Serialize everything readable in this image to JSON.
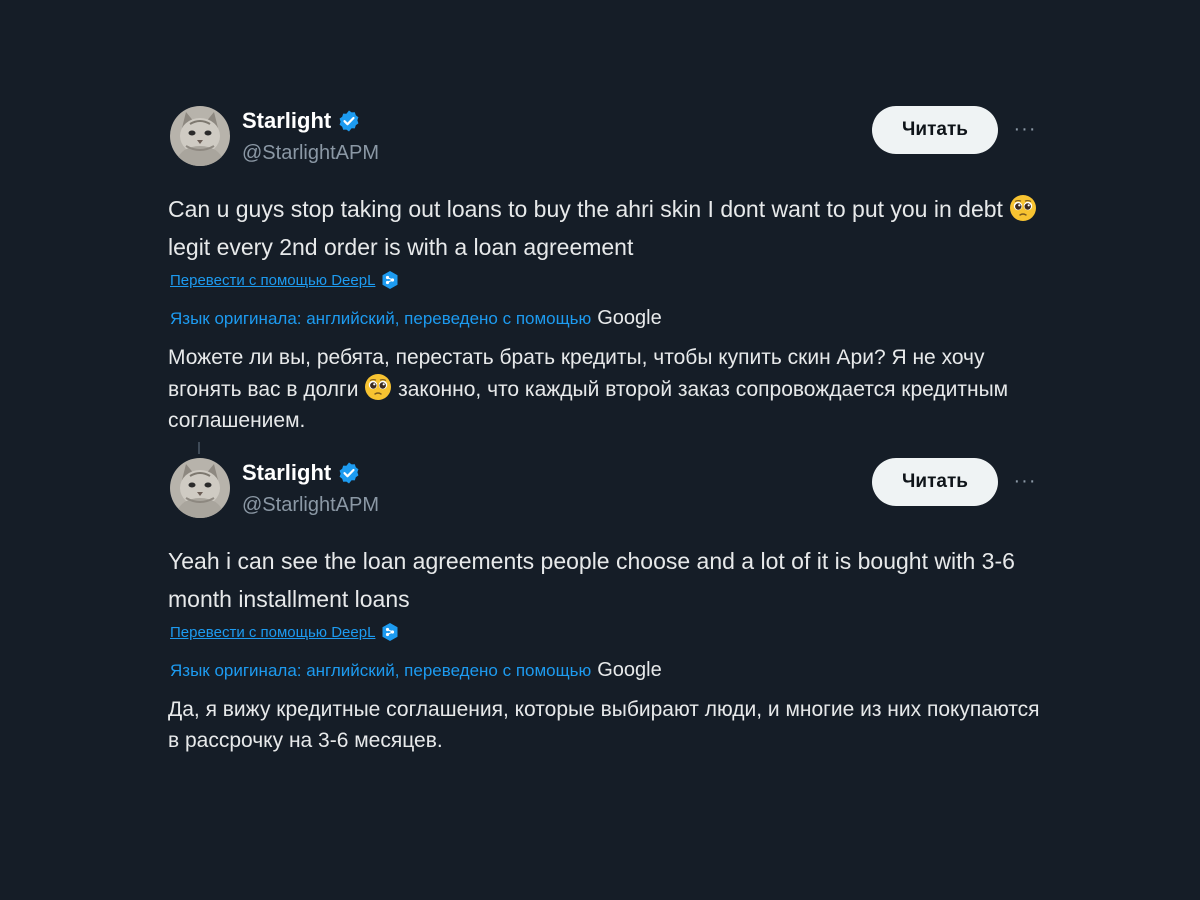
{
  "tweets": [
    {
      "display_name": "Starlight",
      "handle": "@StarlightAPM",
      "follow_label": "Читать",
      "more_label": "···",
      "text_before_emoji": "Can u guys stop taking out loans to buy the ahri skin I dont want to put you in debt",
      "emoji": "pleading-face",
      "text_after_emoji": "legit every 2nd order is with a loan agreement",
      "deepl_label": "Перевести с помощью DeepL",
      "original_language_label": "Язык оригинала: английский, переведено с помощью",
      "google_label": "Google",
      "translated_before_emoji": "Можете ли вы, ребята, перестать брать кредиты, чтобы купить скин Ари? Я не хочу вгонять вас в долги",
      "translated_after_emoji": "законно, что каждый второй заказ сопровождается кредитным соглашением."
    },
    {
      "display_name": "Starlight",
      "handle": "@StarlightAPM",
      "follow_label": "Читать",
      "more_label": "···",
      "text": "Yeah i can see the loan agreements people choose and a lot of it is bought with 3-6 month installment loans",
      "deepl_label": "Перевести с помощью DeepL",
      "original_language_label": "Язык оригинала: английский, переведено с помощью",
      "google_label": "Google",
      "translated": "Да, я вижу кредитные соглашения, которые выбирают люди, и многие из них покупаются в рассрочку на 3-6 месяцев."
    }
  ],
  "colors": {
    "background": "#151d27",
    "link_blue": "#1d9bf0",
    "verified_blue": "#1d9bf0",
    "button_bg": "#eff3f4",
    "secondary_text": "#8b98a5"
  }
}
